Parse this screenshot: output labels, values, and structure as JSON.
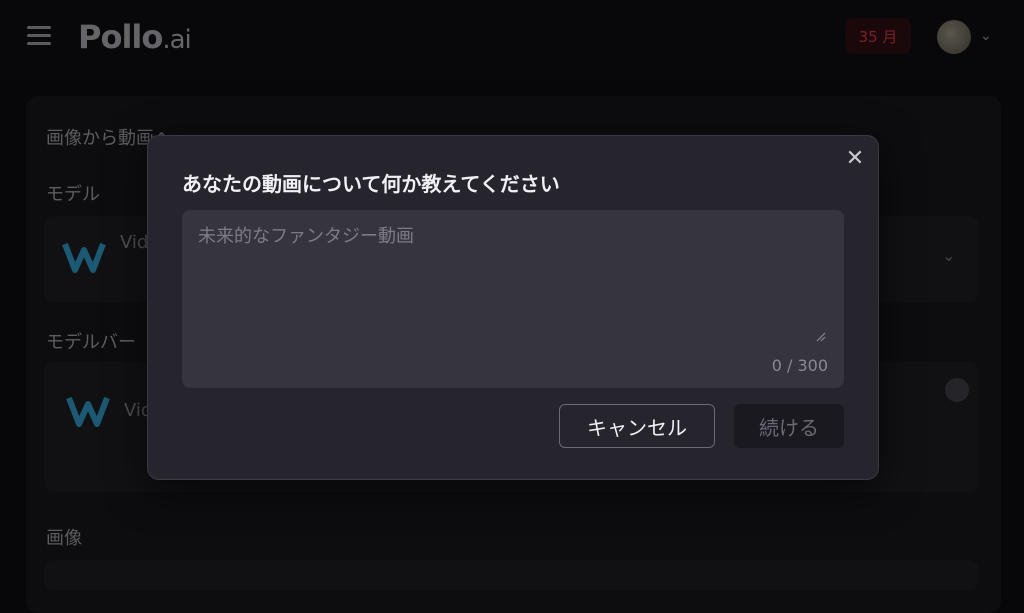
{
  "header": {
    "logo_main": "Pollo",
    "logo_suffix": ".ai",
    "credits_label": "35 月"
  },
  "background": {
    "section_title": "画像から動画へ",
    "model_label": "モデル",
    "model_name": "Vid",
    "model_version_label": "モデルバー",
    "version_name": "Vid",
    "image_label": "画像"
  },
  "modal": {
    "title": "あなたの動画について何か教えてください",
    "prompt_value": "",
    "prompt_placeholder": "未来的なファンタジー動画",
    "char_count": "0 / 300",
    "cancel_label": "キャンセル",
    "continue_label": "続ける"
  },
  "colors": {
    "modal_bg": "#26252e",
    "input_bg": "#36353f",
    "page_bg": "#0b0b0e"
  }
}
